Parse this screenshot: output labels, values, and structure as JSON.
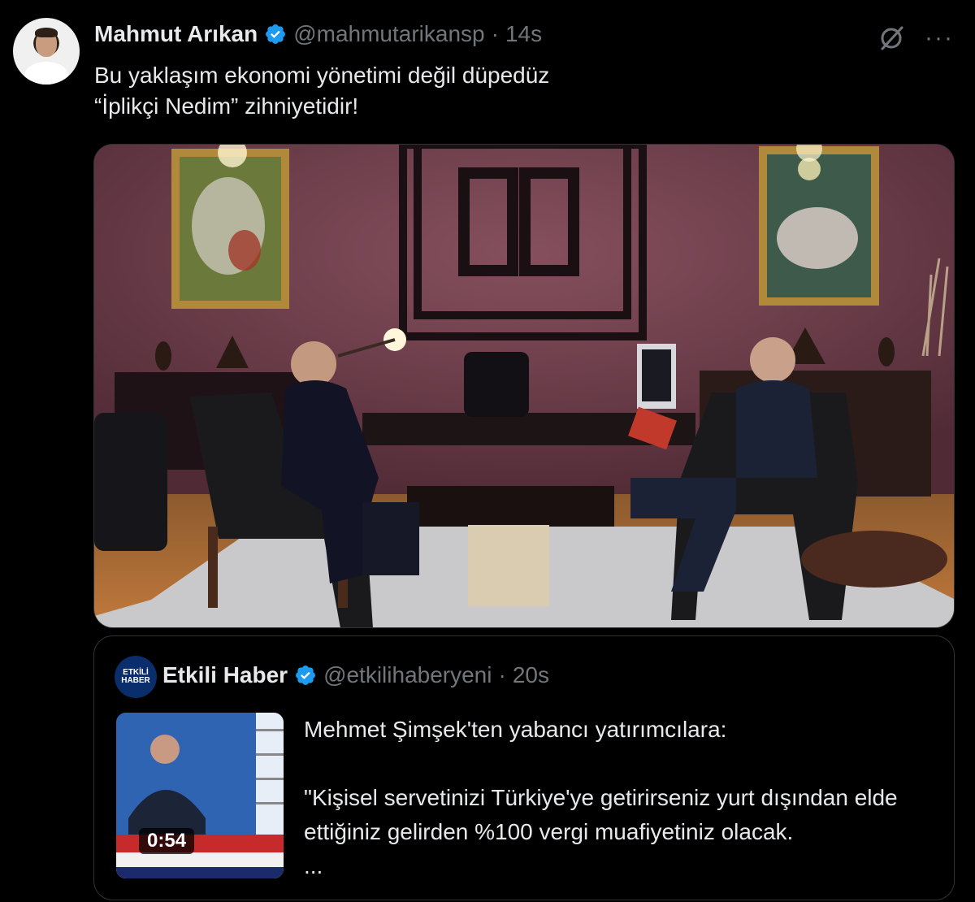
{
  "tweet": {
    "author_name": "Mahmut Arıkan",
    "handle": "@mahmutarikansp",
    "separator": "·",
    "time": "14s",
    "text_line1": "Bu yaklaşım ekonomi yönetimi değil düpedüz",
    "text_line2": "“İplikçi Nedim” zihniyetidir!",
    "more_label": "···"
  },
  "quoted": {
    "author_name": "Etkili Haber",
    "handle": "@etkilihaberyeni",
    "separator": "·",
    "time": "20s",
    "avatar_text": "ETKİLİ HABER",
    "video_duration": "0:54",
    "text": "Mehmet Şimşek'ten yabancı yatırımcılara:\n\n\"Kişisel servetinizi Türkiye'ye getirirseniz yurt dışından elde ettiğiniz gelirden %100 vergi muafiyetiniz olacak.\n..."
  },
  "colors": {
    "background": "#000000",
    "text": "#e7e9ea",
    "muted": "#71767b",
    "verified": "#1d9bf0",
    "border": "#2f3336"
  },
  "icons": {
    "verified": "verified-badge-icon",
    "grok": "grok-icon",
    "more": "more-icon"
  }
}
